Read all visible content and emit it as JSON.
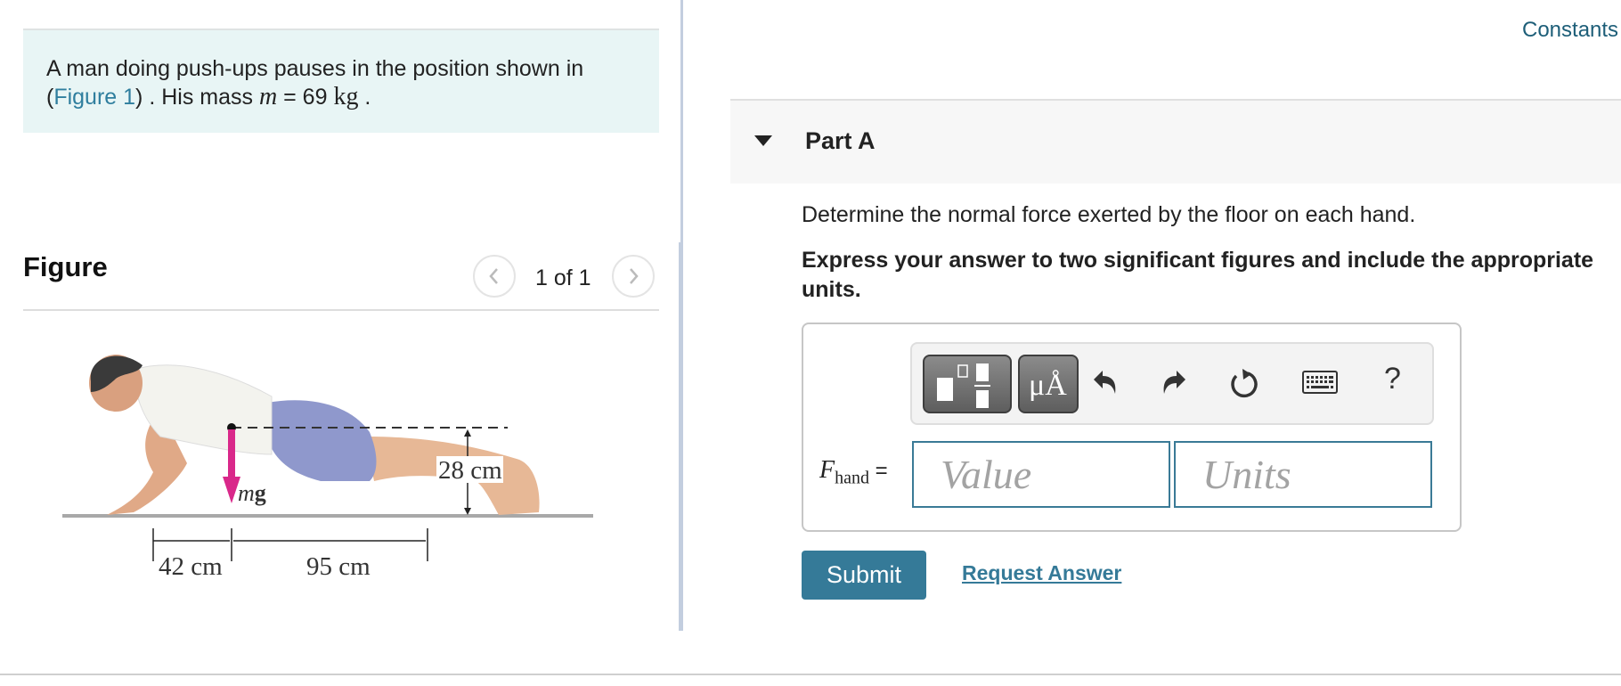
{
  "problem": {
    "text_before": "A man doing push-ups pauses in the position shown in (",
    "figure_link": "Figure 1",
    "text_after": ") . His mass ",
    "var": "m",
    "equals": " = 69 ",
    "unit": "kg",
    "end": " ."
  },
  "figure_panel": {
    "title": "Figure",
    "pager": "1 of 1",
    "prev_icon": "chevron-left-icon",
    "next_icon": "chevron-right-icon",
    "labels": {
      "force": "mg",
      "height": "28 cm",
      "hand_to_cg": "42 cm",
      "cg_to_feet": "95 cm"
    },
    "colors": {
      "force_arrow": "#d9288a",
      "shorts": "#8f98cc",
      "floor": "#a8a8a8"
    }
  },
  "header": {
    "constants_link": "Constants"
  },
  "part": {
    "title": "Part A",
    "question": "Determine the normal force exerted by the floor on each hand.",
    "instruction": "Express your answer to two significant figures and include the appropriate units."
  },
  "toolbar": {
    "items": [
      {
        "name": "templates",
        "icon": "templates-icon"
      },
      {
        "name": "units",
        "label": "μÅ",
        "icon": "units-icon"
      },
      {
        "name": "undo",
        "icon": "undo-icon"
      },
      {
        "name": "redo",
        "icon": "redo-icon"
      },
      {
        "name": "reset",
        "icon": "reset-icon"
      },
      {
        "name": "keyboard",
        "icon": "keyboard-icon"
      },
      {
        "name": "help",
        "label": "?",
        "icon": "help-icon"
      }
    ]
  },
  "answer": {
    "label_var": "F",
    "label_sub": "hand",
    "label_eq": " =",
    "value_placeholder": "Value",
    "units_placeholder": "Units",
    "value": "",
    "units": ""
  },
  "actions": {
    "submit": "Submit",
    "request_answer": "Request Answer"
  },
  "colors": {
    "accent": "#357a98",
    "link": "#2f7e9e",
    "problem_bg": "#e8f5f5",
    "part_bg": "#f7f7f7"
  }
}
